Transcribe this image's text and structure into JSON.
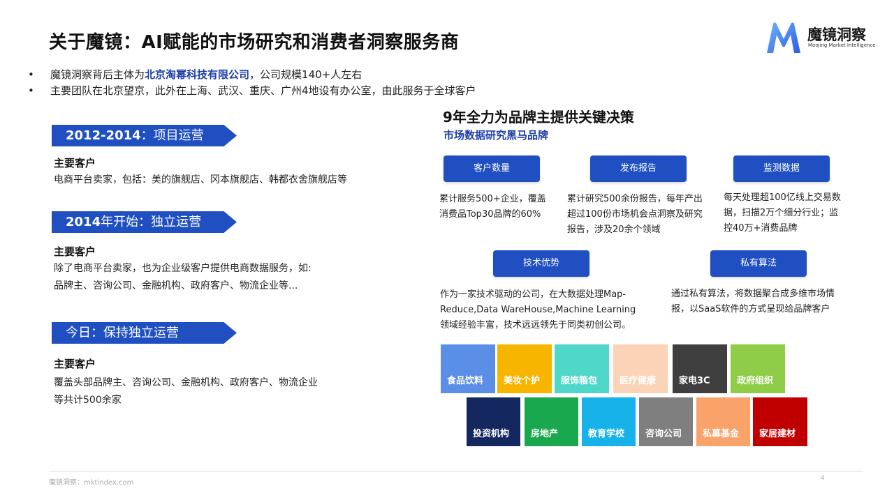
{
  "title": "关于魔镜：AI赋能的市场研究和消费者洞察服务商",
  "logo": {
    "name": "魔镜洞察",
    "subtitle": "Moojing Market Intelligence"
  },
  "bullets": [
    {
      "pre": "魔镜洞察背后主体为",
      "highlight": "北京淘幂科技有限公司",
      "post": "，公司规模140+人左右"
    },
    {
      "text": "主要团队在北京望京，此外在上海、武汉、重庆、广州4地设有办公室，由此服务于全球客户"
    }
  ],
  "timeline": [
    {
      "year": "2012-2014",
      "rest": "：项目运营",
      "heading": "主要客户",
      "lines": [
        "电商平台卖家，包括：美的旗舰店、冈本旗舰店、韩都衣舍旗舰店等"
      ]
    },
    {
      "year": "2014",
      "rest": "年开始：独立运营",
      "heading": "主要客户",
      "lines": [
        "除了电商平台卖家，也为企业级客户提供电商数据服务，如:",
        "品牌主、咨询公司、金融机构、政府客户、物流企业等..."
      ]
    },
    {
      "year": "",
      "rest": "今日：保持独立运营",
      "heading": "主要客户",
      "lines": [
        "覆盖头部品牌主、咨询公司、金融机构、政府客户、物流企业",
        "等共计500余家"
      ]
    }
  ],
  "right": {
    "title": "9年全力为品牌主提供关键决策",
    "subtitle": "市场数据研究黑马品牌",
    "features": [
      {
        "label": "客户数量",
        "desc": [
          "累计服务500+企业，覆盖",
          "消费品Top30品牌的60%"
        ]
      },
      {
        "label": "发布报告",
        "desc": [
          "累计研究500余份报告，每年产出",
          "超过100份市场机会点洞察及研究",
          "报告，涉及20余个领域"
        ]
      },
      {
        "label": "监测数据",
        "desc": [
          "每天处理超100亿线上交易数",
          "据，扫描2万个细分行业；监",
          "控40万+消费品牌"
        ]
      },
      {
        "label": "技术优势",
        "desc": [
          "作为一家技术驱动的公司，在大数据处理Map-",
          "Reduce,Data WareHouse,Machine Learning",
          "领域经验丰富，技术远远领先于同类初创公司。"
        ]
      },
      {
        "label": "私有算法",
        "desc": [
          "通过私有算法，将数据聚合成多维市场情",
          "报，以SaaS软件的方式呈现给品牌客户"
        ]
      }
    ],
    "industries_row1": [
      {
        "label": "食品饮料",
        "color": "#5b8ee6"
      },
      {
        "label": "美妆个护",
        "color": "#f7b500"
      },
      {
        "label": "服饰箱包",
        "color": "#4fd8c9"
      },
      {
        "label": "医疗健康",
        "color": "#fbd3b7"
      },
      {
        "label": "家电3C",
        "color": "#3f3f3f"
      },
      {
        "label": "政府组织",
        "color": "#8fcc48"
      }
    ],
    "industries_row2": [
      {
        "label": "投资机构",
        "color": "#14285f"
      },
      {
        "label": "房地产",
        "color": "#1aa84e"
      },
      {
        "label": "教育学校",
        "color": "#17b2ea"
      },
      {
        "label": "咨询公司",
        "color": "#7f7f7f"
      },
      {
        "label": "私募基金",
        "color": "#f9a36b"
      },
      {
        "label": "家居建材",
        "color": "#c00000"
      }
    ]
  },
  "footer": "魔镜洞察：mktindex.com",
  "page_number": "4"
}
